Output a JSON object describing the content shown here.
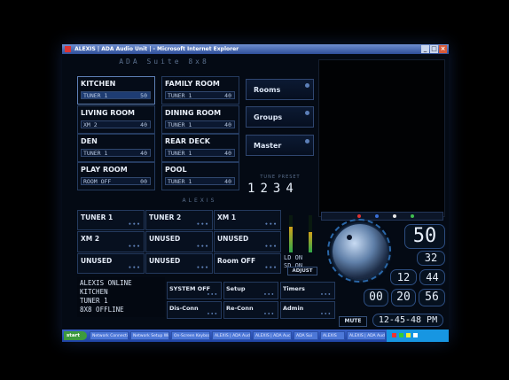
{
  "window": {
    "title": "ALEXIS | ADA Audio Unit | - Microsoft Internet Explorer",
    "min": "_",
    "max": "□",
    "close": "×"
  },
  "logo": "ADA Suite 8x8",
  "rooms": [
    {
      "name": "KITCHEN",
      "source": "TUNER 1",
      "volume": "50",
      "selected": true
    },
    {
      "name": "FAMILY ROOM",
      "source": "TUNER 1",
      "volume": "40",
      "selected": false
    },
    {
      "name": "LIVING ROOM",
      "source": "XM 2",
      "volume": "40",
      "selected": false
    },
    {
      "name": "DINING ROOM",
      "source": "TUNER 1",
      "volume": "40",
      "selected": false
    },
    {
      "name": "DEN",
      "source": "TUNER 1",
      "volume": "40",
      "selected": false
    },
    {
      "name": "REAR DECK",
      "source": "TUNER 1",
      "volume": "40",
      "selected": false
    },
    {
      "name": "PLAY ROOM",
      "source": "ROOM OFF",
      "volume": "00",
      "selected": false
    },
    {
      "name": "POOL",
      "source": "TUNER 1",
      "volume": "40",
      "selected": false
    }
  ],
  "nav": {
    "rooms": "Rooms",
    "groups": "Groups",
    "master": "Master"
  },
  "presets": {
    "label": "TUNE PRESET",
    "values": [
      "1",
      "2",
      "3",
      "4"
    ]
  },
  "brand": "ALEXIS",
  "sources": [
    {
      "label": "TUNER 1"
    },
    {
      "label": "TUNER 2"
    },
    {
      "label": "XM 1"
    },
    {
      "label": "XM 2"
    },
    {
      "label": "UNUSED"
    },
    {
      "label": "UNUSED"
    },
    {
      "label": "UNUSED"
    },
    {
      "label": "UNUSED"
    },
    {
      "label": "Room OFF"
    }
  ],
  "levels": {
    "ld": "LD",
    "ld_val": "ON",
    "sd": "SD",
    "sd_val": "ON",
    "adjust": "ADJUST",
    "meter_left": 0.7,
    "meter_right": 0.55
  },
  "displays": {
    "volume": "50",
    "bass": "32",
    "treble": "12",
    "balance": "44",
    "a": "00",
    "b": "20",
    "c": "56"
  },
  "status": {
    "line1": "ALEXIS ONLINE",
    "line2": "KITCHEN",
    "line3": "TUNER 1",
    "line4": "8X8 OFFLINE"
  },
  "system": {
    "system_off": "SYSTEM OFF",
    "setup": "Setup",
    "timers": "Timers",
    "disconn": "Dis-Conn",
    "reconn": "Re-Conn",
    "admin": "Admin"
  },
  "mute": "MUTE",
  "clock": "12-45-48 PM",
  "taskbar": {
    "start": "start",
    "items": [
      "Network Connections",
      "Network Setup Wiz",
      "On-Screen Keyboard",
      "ALEXIS | ADA Aud",
      "ALEXIS | ADA Auc",
      "ADA Sui",
      "ALEXIS",
      "ALEXIS | ADA Aud"
    ]
  }
}
